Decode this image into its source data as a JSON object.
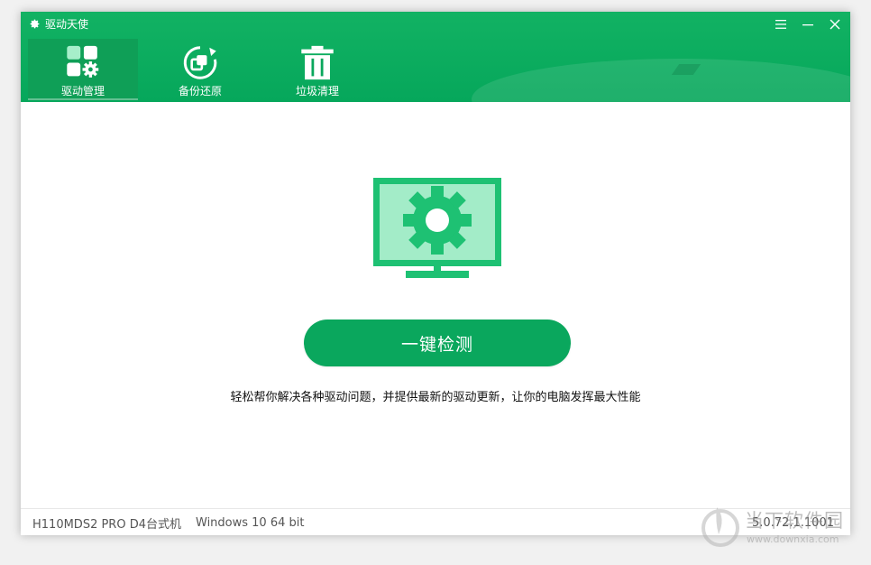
{
  "app": {
    "title": "驱动天使"
  },
  "window_controls": [
    {
      "name": "menu-icon"
    },
    {
      "name": "minimize-icon"
    },
    {
      "name": "close-icon"
    }
  ],
  "nav": {
    "items": [
      {
        "label": "驱动管理",
        "icon": "driver-manage-icon",
        "active": true
      },
      {
        "label": "备份还原",
        "icon": "backup-restore-icon",
        "active": false
      },
      {
        "label": "垃圾清理",
        "icon": "trash-clean-icon",
        "active": false
      }
    ]
  },
  "main": {
    "scan_button": "一键检测",
    "tagline": "轻松帮你解决各种驱动问题，并提供最新的驱动更新，让你的电脑发挥最大性能"
  },
  "status": {
    "model": "H110MDS2 PRO D4台式机",
    "os": "Windows 10 64 bit",
    "version": "5.0.72.1.1001"
  },
  "watermark": {
    "text": "当下软件园",
    "url": "www.downxia.com"
  },
  "colors": {
    "brand": "#06a75b",
    "brand_dark": "#0f9f57",
    "monitor_screen": "#a3ecc8",
    "gear": "#1fc173"
  }
}
